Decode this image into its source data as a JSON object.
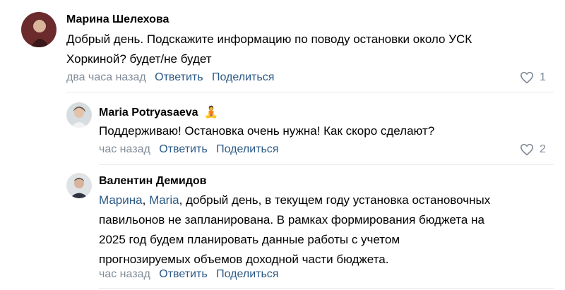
{
  "comments": [
    {
      "author": "Марина Шелехова",
      "text_lines": [
        "Добрый день. Подскажите информацию по поводу остановки около УСК",
        "Хоркиной? будет/не будет"
      ],
      "time": "два часа назад",
      "reply_label": "Ответить",
      "share_label": "Поделиться",
      "likes": "1"
    },
    {
      "author": "Maria Potryasaeva",
      "author_emoji": "🧘",
      "text": "Поддерживаю! Остановка очень нужна! Как скоро сделают?",
      "time": "час назад",
      "reply_label": "Ответить",
      "share_label": "Поделиться",
      "likes": "2"
    },
    {
      "author": "Валентин Демидов",
      "mention_1": "Марина",
      "mention_sep": ", ",
      "mention_2": "Maria",
      "text_first": ", добрый день, в текущем году установка остановочных",
      "text_lines": [
        "павильонов не запланирована. В рамках формирования бюджета на",
        "2025 год будем планировать данные работы с учетом",
        "прогнозируемых объемов доходной части бюджета."
      ],
      "time": "час назад",
      "reply_label": "Ответить",
      "share_label": "Поделиться"
    }
  ],
  "colors": {
    "link": "#2a5885",
    "meta": "#818c99",
    "divider": "#e7e8ec"
  }
}
